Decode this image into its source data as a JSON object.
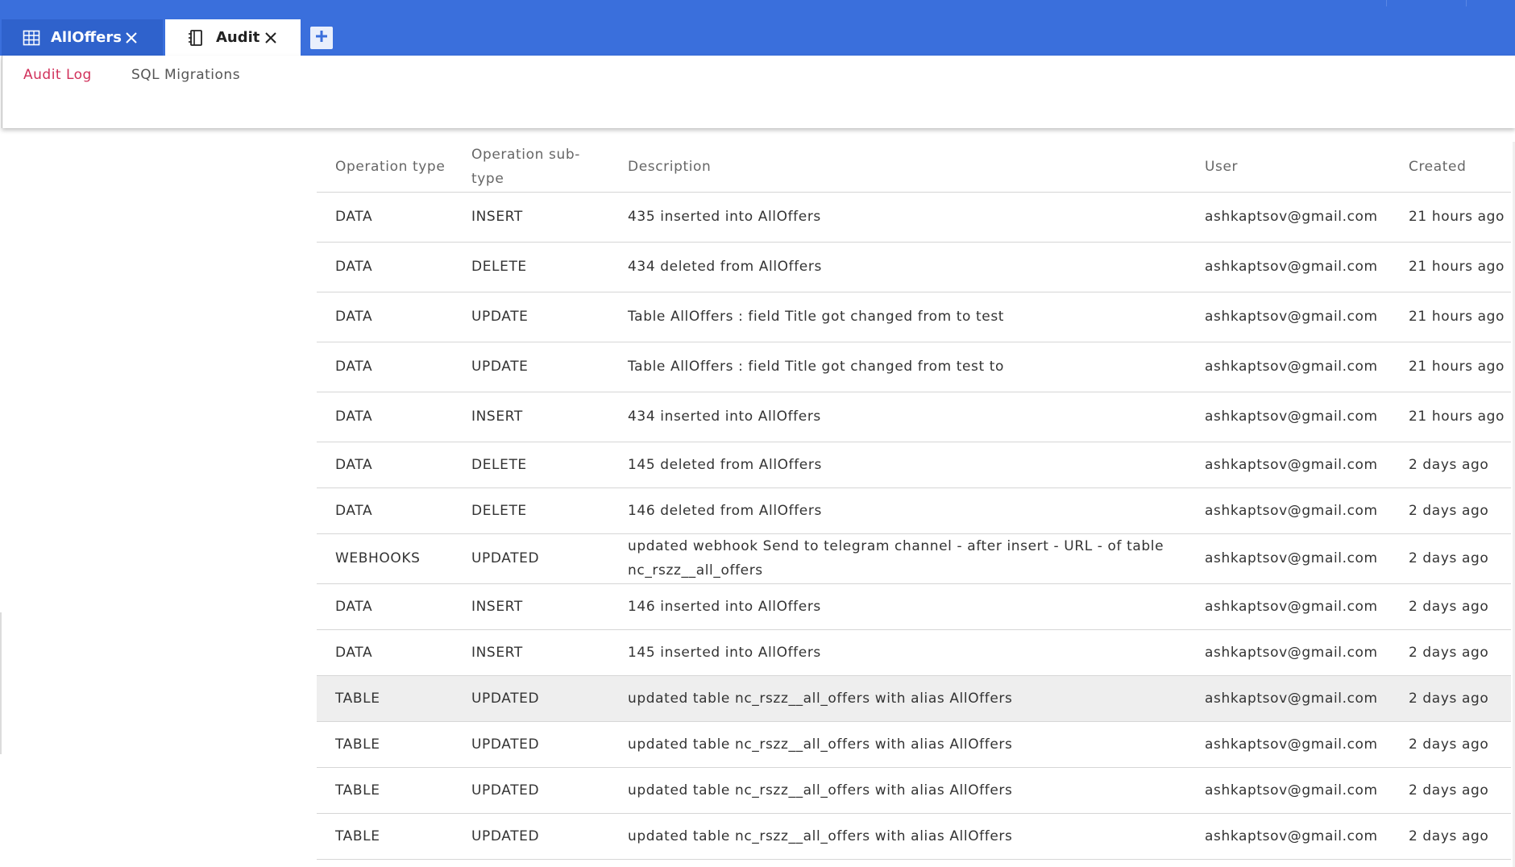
{
  "tabs": [
    {
      "label": "AllOffers",
      "icon": "grid-icon",
      "active": false
    },
    {
      "label": "Audit",
      "icon": "notebook-icon",
      "active": true
    }
  ],
  "subtabs": {
    "audit_log": "Audit Log",
    "sql_migrations": "SQL Migrations"
  },
  "colors": {
    "topbar": "#3a6fdc",
    "active_subtab": "#d1315b"
  },
  "table": {
    "headers": {
      "operation_type": "Operation type",
      "operation_sub_type": "Operation sub-type",
      "description": "Description",
      "user": "User",
      "created": "Created"
    },
    "rows": [
      {
        "type": "DATA",
        "subtype": "INSERT",
        "description": "435 inserted into AllOffers",
        "user": "ashkaptsov@gmail.com",
        "created": "21 hours ago"
      },
      {
        "type": "DATA",
        "subtype": "DELETE",
        "description": "434 deleted from AllOffers",
        "user": "ashkaptsov@gmail.com",
        "created": "21 hours ago"
      },
      {
        "type": "DATA",
        "subtype": "UPDATE",
        "description": "Table AllOffers : field Title got changed from to test",
        "user": "ashkaptsov@gmail.com",
        "created": "21 hours ago"
      },
      {
        "type": "DATA",
        "subtype": "UPDATE",
        "description": "Table AllOffers : field Title got changed from test to",
        "user": "ashkaptsov@gmail.com",
        "created": "21 hours ago"
      },
      {
        "type": "DATA",
        "subtype": "INSERT",
        "description": "434 inserted into AllOffers",
        "user": "ashkaptsov@gmail.com",
        "created": "21 hours ago"
      },
      {
        "type": "DATA",
        "subtype": "DELETE",
        "description": "145 deleted from AllOffers",
        "user": "ashkaptsov@gmail.com",
        "created": "2 days ago"
      },
      {
        "type": "DATA",
        "subtype": "DELETE",
        "description": "146 deleted from AllOffers",
        "user": "ashkaptsov@gmail.com",
        "created": "2 days ago"
      },
      {
        "type": "WEBHOOKS",
        "subtype": "UPDATED",
        "description": "updated webhook Send to telegram channel - after insert - URL - of table nc_rszz__all_offers",
        "user": "ashkaptsov@gmail.com",
        "created": "2 days ago"
      },
      {
        "type": "DATA",
        "subtype": "INSERT",
        "description": "146 inserted into AllOffers",
        "user": "ashkaptsov@gmail.com",
        "created": "2 days ago"
      },
      {
        "type": "DATA",
        "subtype": "INSERT",
        "description": "145 inserted into AllOffers",
        "user": "ashkaptsov@gmail.com",
        "created": "2 days ago"
      },
      {
        "type": "TABLE",
        "subtype": "UPDATED",
        "description": "updated table nc_rszz__all_offers with alias AllOffers",
        "user": "ashkaptsov@gmail.com",
        "created": "2 days ago"
      },
      {
        "type": "TABLE",
        "subtype": "UPDATED",
        "description": "updated table nc_rszz__all_offers with alias AllOffers",
        "user": "ashkaptsov@gmail.com",
        "created": "2 days ago"
      },
      {
        "type": "TABLE",
        "subtype": "UPDATED",
        "description": "updated table nc_rszz__all_offers with alias AllOffers",
        "user": "ashkaptsov@gmail.com",
        "created": "2 days ago"
      },
      {
        "type": "TABLE",
        "subtype": "UPDATED",
        "description": "updated table nc_rszz__all_offers with alias AllOffers",
        "user": "ashkaptsov@gmail.com",
        "created": "2 days ago"
      }
    ]
  }
}
